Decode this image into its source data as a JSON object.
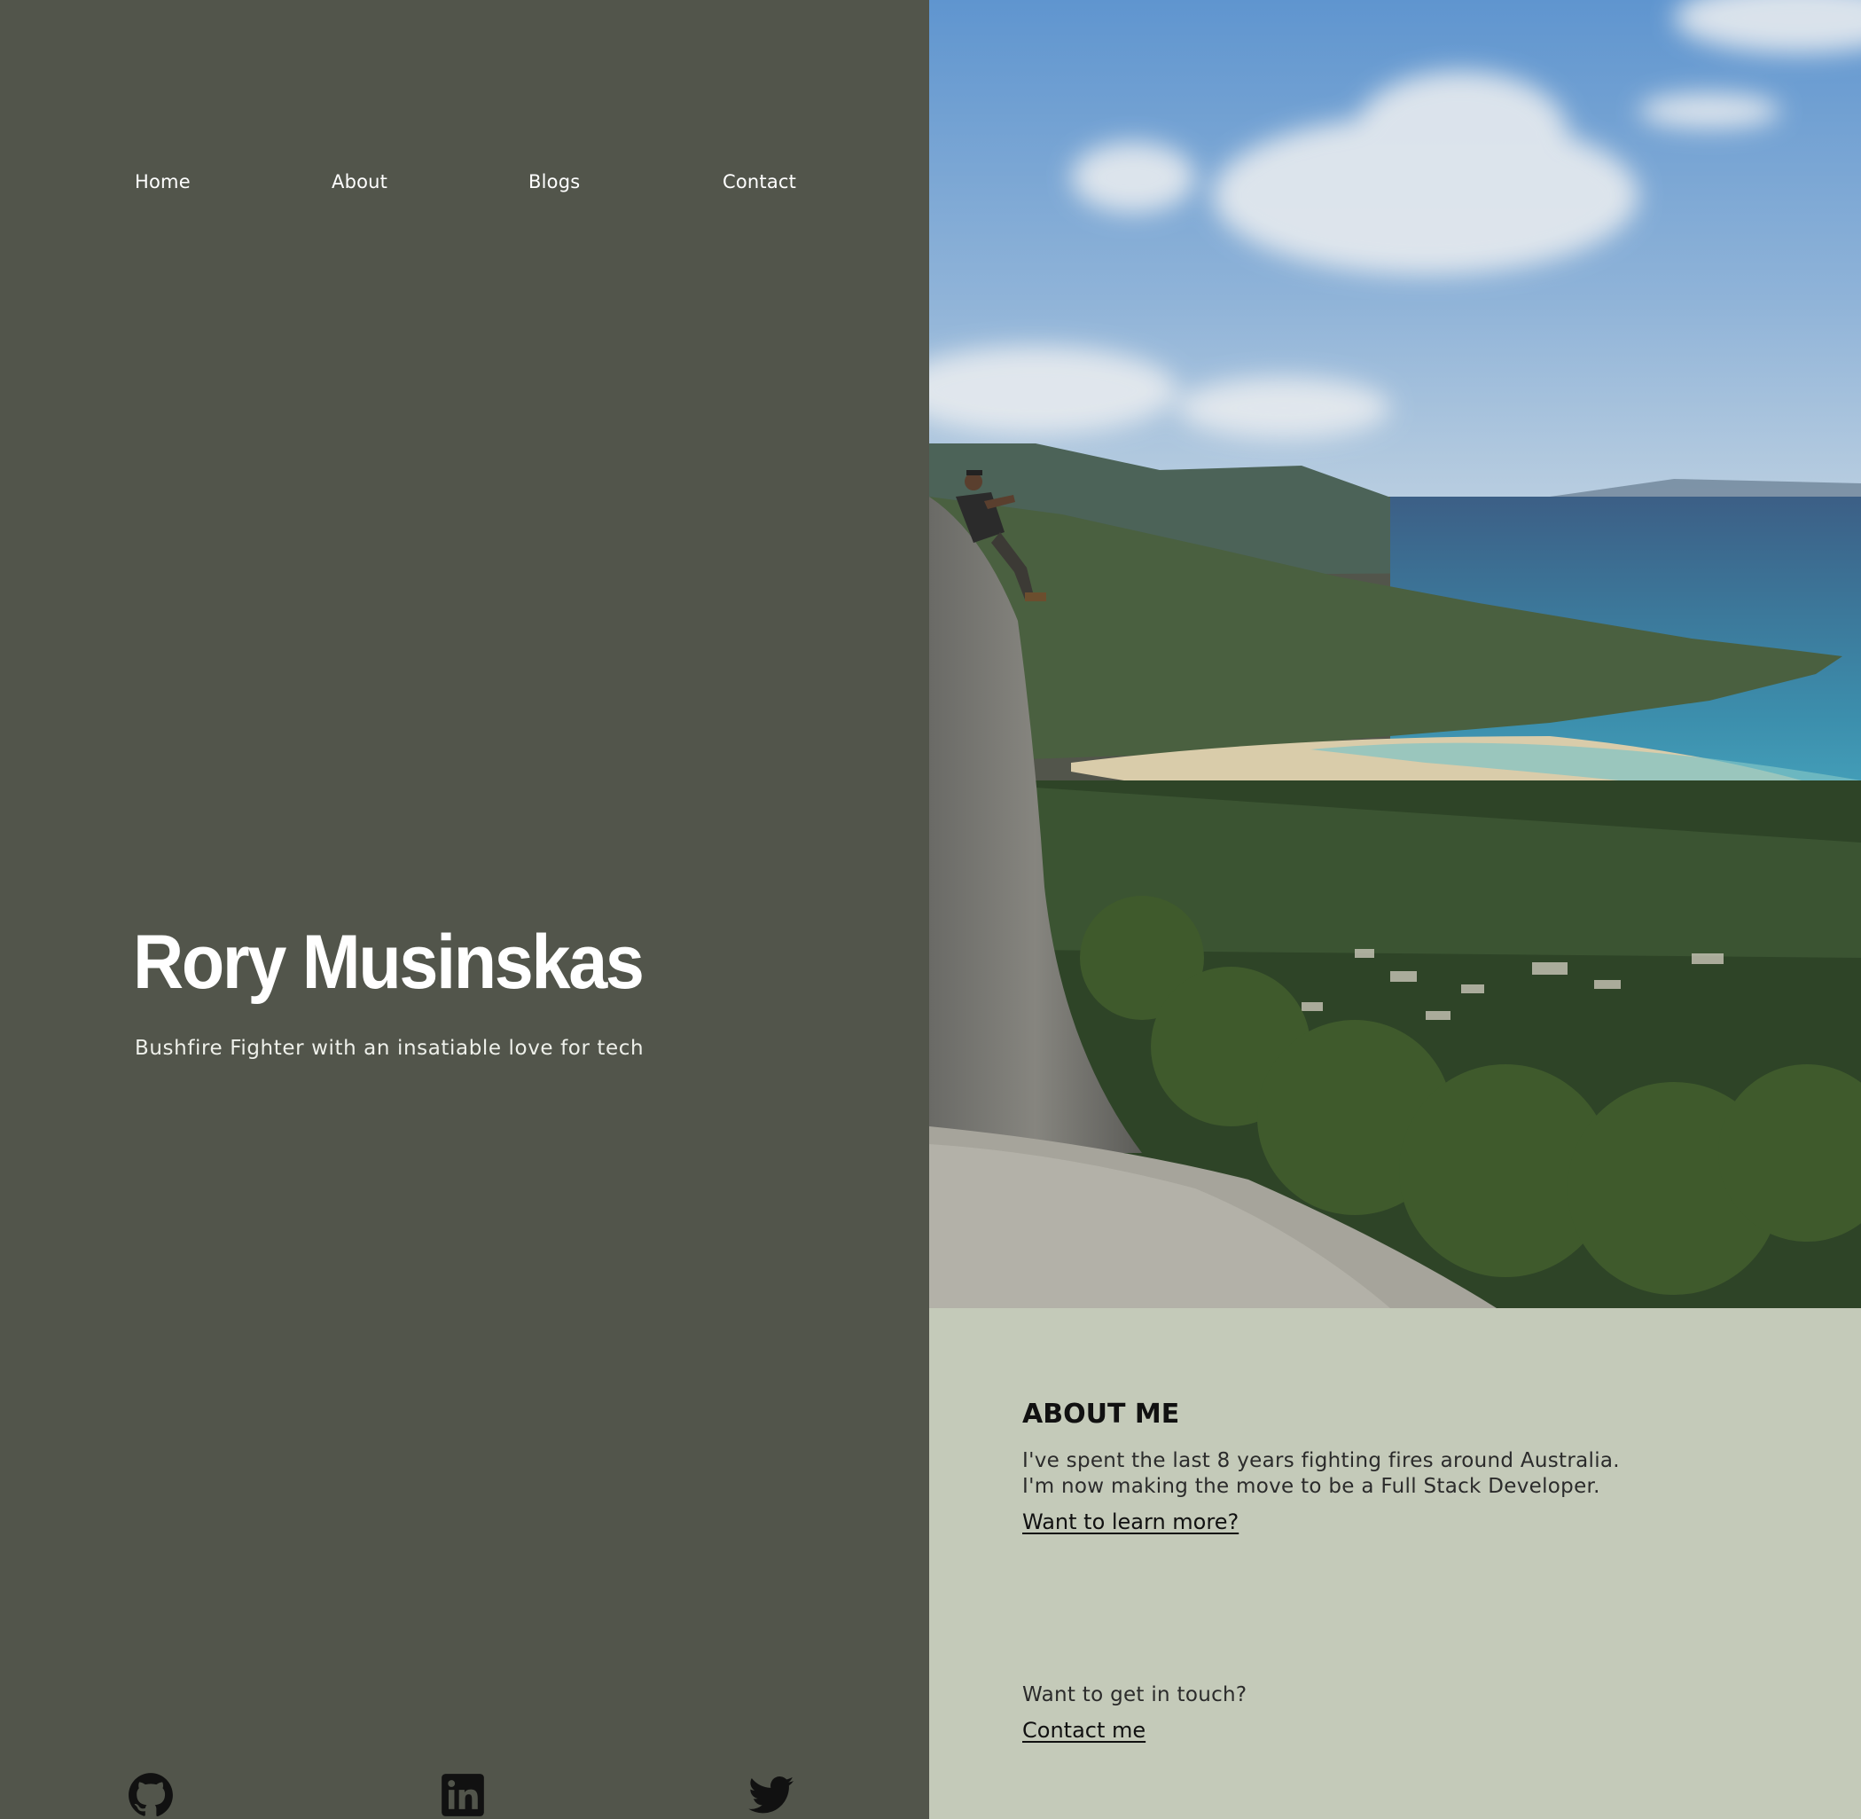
{
  "nav": {
    "items": [
      {
        "label": "Home"
      },
      {
        "label": "About"
      },
      {
        "label": "Blogs"
      },
      {
        "label": "Contact"
      }
    ]
  },
  "hero": {
    "name": "Rory Musinskas",
    "tagline": "Bushfire Fighter with an insatiable love for tech"
  },
  "about": {
    "title": "ABOUT ME",
    "line1": "I've spent the last 8 years fighting fires around Australia.",
    "line2": "I'm now making the move to be a Full Stack Developer.",
    "learn_more": "Want to learn more?",
    "touch_prompt": "Want to get in touch?",
    "contact_link": "Contact me"
  },
  "social": [
    {
      "icon": "github-icon"
    },
    {
      "icon": "linkedin-icon"
    },
    {
      "icon": "twitter-icon"
    }
  ],
  "colors": {
    "left_panel": "#52554b",
    "about_panel": "#c4cab9",
    "text_light": "#ffffff",
    "text_dark": "#111111"
  }
}
